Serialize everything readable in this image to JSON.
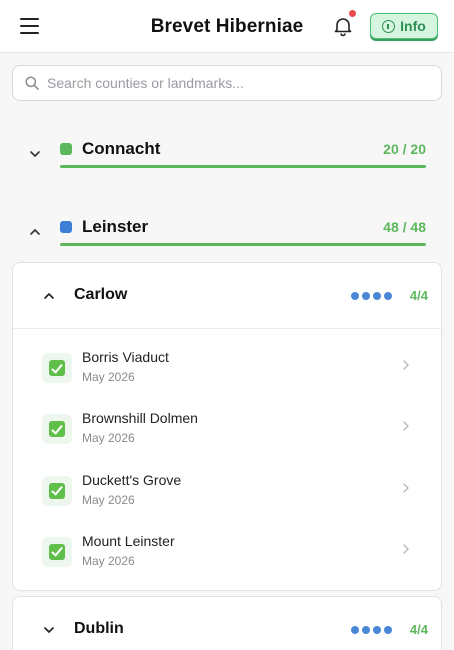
{
  "app": {
    "title": "Brevet Hiberniae"
  },
  "header": {
    "info_label": "Info",
    "notification_unread": true
  },
  "search": {
    "placeholder": "Search counties or landmarks...",
    "value": ""
  },
  "provinces": [
    {
      "name": "Connacht",
      "count": "20 / 20",
      "color": "#5cb85c",
      "expanded": false,
      "progress": 1.0
    },
    {
      "name": "Leinster",
      "count": "48 / 48",
      "color": "#3d7fd6",
      "expanded": true,
      "progress": 1.0
    }
  ],
  "counties": [
    {
      "name": "Carlow",
      "count": "4/4",
      "expanded": true,
      "landmarks": [
        {
          "name": "Borris Viaduct",
          "date": "May 2026"
        },
        {
          "name": "Brownshill Dolmen",
          "date": "May 2026"
        },
        {
          "name": "Duckett's Grove",
          "date": "May 2026"
        },
        {
          "name": "Mount Leinster",
          "date": "May 2026"
        }
      ]
    },
    {
      "name": "Dublin",
      "count": "4/4",
      "expanded": false
    }
  ],
  "colors": {
    "accent_green": "#5cb85c",
    "accent_blue": "#4a87d6",
    "notification": "#e5484d"
  },
  "icons": [
    "menu-icon",
    "bell-icon",
    "info-icon",
    "search-icon",
    "chevron-down-icon",
    "chevron-up-icon",
    "chevron-right-icon",
    "checkmark-icon"
  ]
}
